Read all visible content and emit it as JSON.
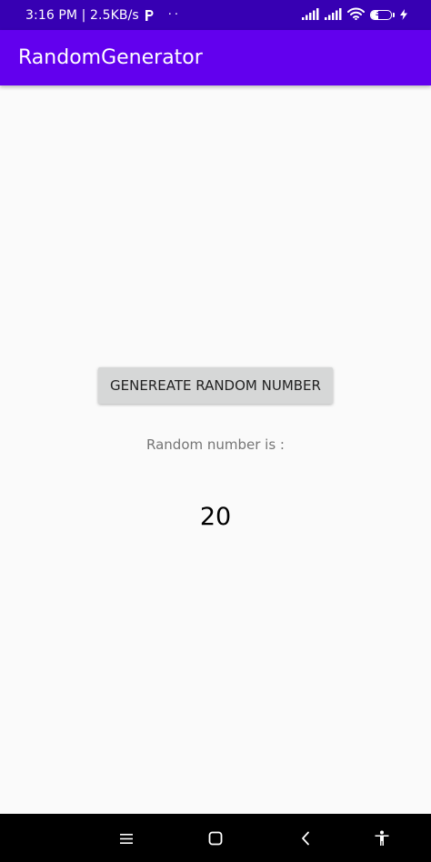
{
  "status_bar": {
    "time_speed": "3:16 PM | 2.5KB/s",
    "dots": "··",
    "battery_level": "37",
    "battery_fraction": 0.37,
    "background": "#3700b3"
  },
  "app_bar": {
    "title": "RandomGenerator",
    "background": "#6200ee"
  },
  "main": {
    "generate_button_label": "GENEREATE RANDOM NUMBER",
    "result_label": "Random number is :",
    "result_value": "20"
  },
  "nav_bar": {
    "icons": [
      "menu-icon",
      "home-icon",
      "back-icon",
      "accessibility-icon"
    ]
  }
}
